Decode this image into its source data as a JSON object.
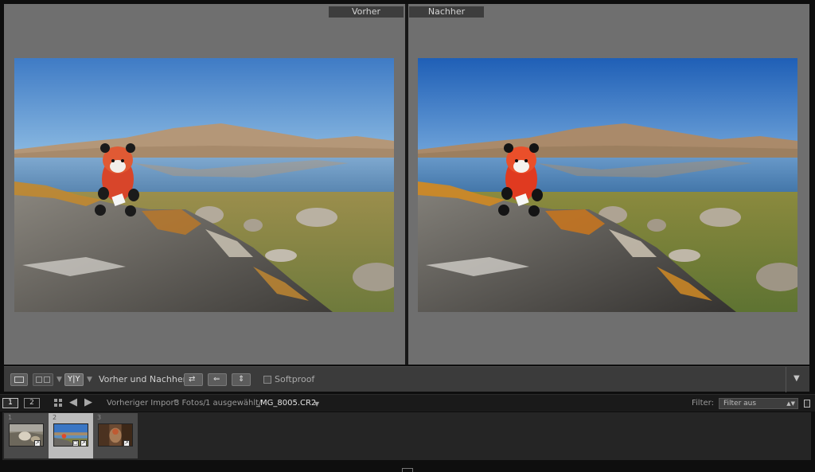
{
  "compare": {
    "before_label": "Vorher",
    "after_label": "Nachher"
  },
  "toolbar": {
    "before_after_label": "Vorher und Nachher:",
    "softproof_label": "Softproof",
    "yy_label": "Y|Y",
    "softproof_checked": false
  },
  "filmstrip_header": {
    "monitor_1": "1",
    "monitor_2": "2",
    "source": "Vorheriger Import",
    "count": "3 Fotos/",
    "selected": "1 ausgewählt/",
    "filename": "_MG_8005.CR2",
    "filter_label": "Filter:",
    "filter_value": "Filter aus"
  },
  "filmstrip": {
    "thumbs": [
      {
        "index": "1",
        "active": false
      },
      {
        "index": "2",
        "active": true
      },
      {
        "index": "3",
        "active": false
      }
    ]
  },
  "colors": {
    "panel_bg": "#6f6f6f",
    "toolbar_bg": "#3b3b3b",
    "app_bg": "#0e0e0e"
  }
}
